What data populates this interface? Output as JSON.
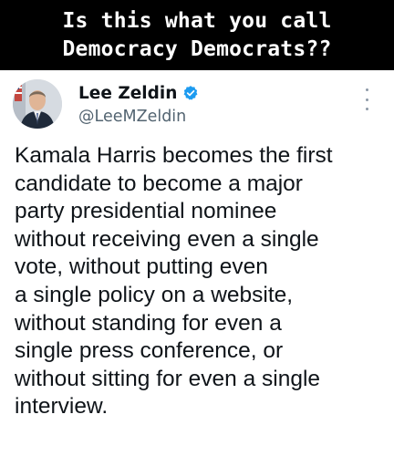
{
  "banner": {
    "lines": [
      "Is this what you call",
      "Democracy Democrats??"
    ]
  },
  "tweet": {
    "author": {
      "display_name": "Lee Zeldin",
      "handle": "@LeeMZeldin",
      "verified_badge_icon": "verified-check-icon",
      "avatar_icon": "profile-photo"
    },
    "more_options_icon": "more-vertical-icon",
    "text_lines": [
      "Kamala Harris becomes the first",
      "candidate to become a major",
      "party presidential nominee",
      "without receiving even a single",
      "vote, without putting even",
      "a single policy on a website,",
      "without standing for even a",
      "single press conference, or",
      "without sitting for even a single",
      "interview."
    ]
  },
  "colors": {
    "banner_bg": "#000000",
    "banner_text": "#ffffff",
    "name_text": "#0f1419",
    "handle_text": "#536471",
    "verified_blue": "#1d9bf0"
  }
}
